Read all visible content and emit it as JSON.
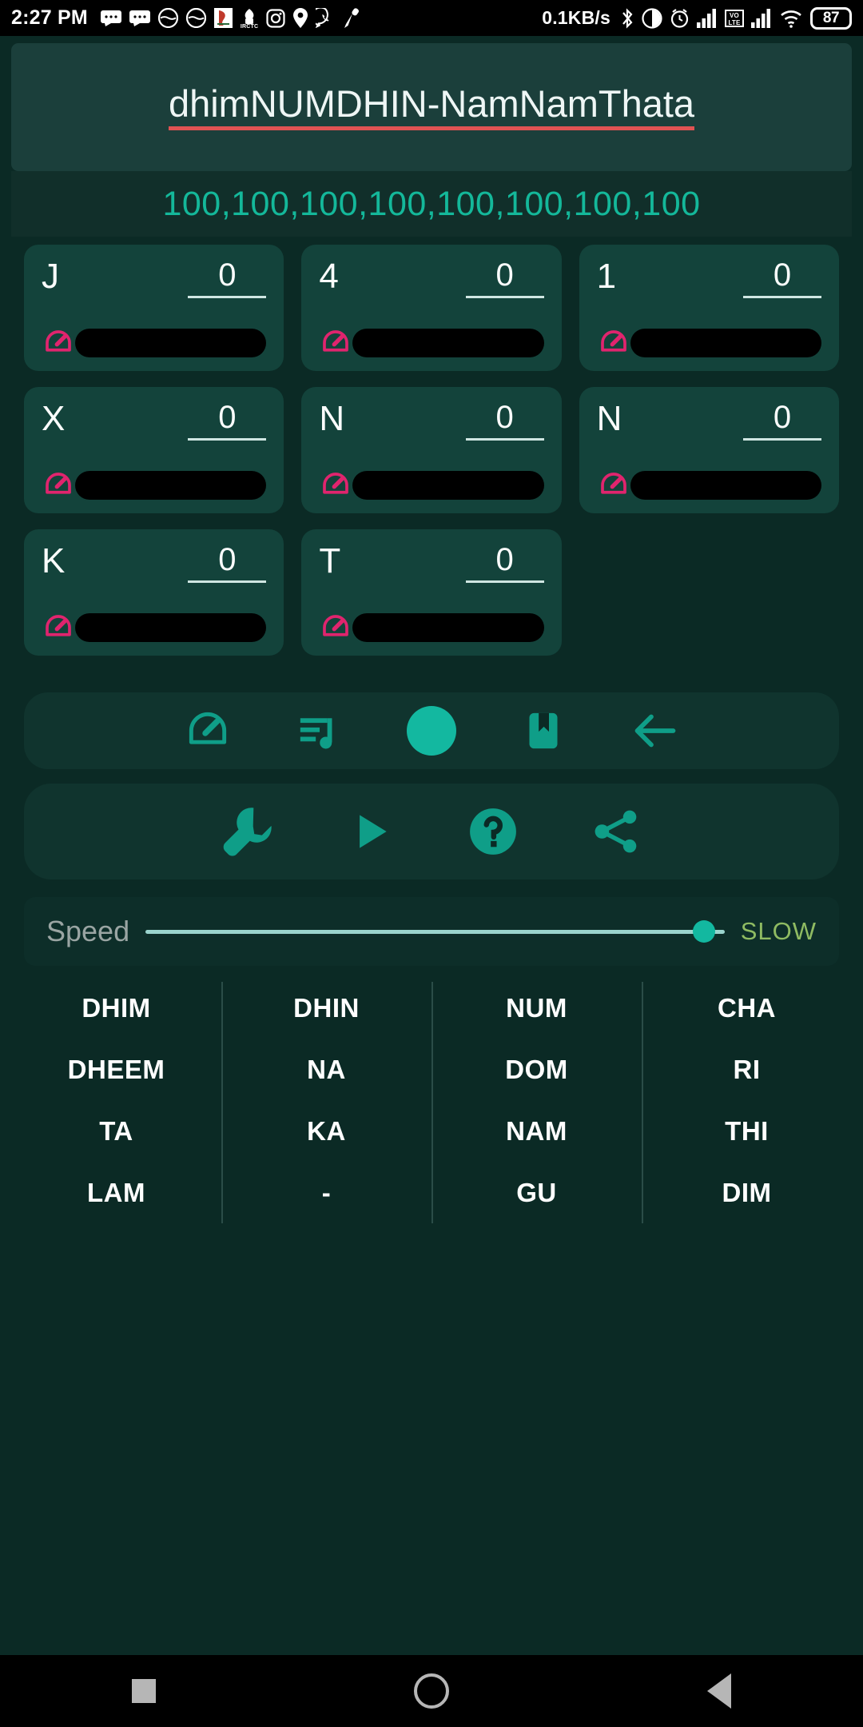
{
  "statusbar": {
    "clock": "2:27 PM",
    "net_rate": "0.1KB/s",
    "battery": "87",
    "left_icons": [
      "message-icon",
      "message-icon",
      "fitness-icon",
      "fitness-icon",
      "indian-rail-icon",
      "irctc-icon",
      "instagram-icon",
      "location-pin-icon",
      "whatsapp-icon",
      "mic-icon"
    ],
    "right_icons": [
      "bluetooth-icon",
      "dnd-icon",
      "alarm-icon",
      "signal-bars-icon",
      "volte-icon",
      "signal-bars-icon",
      "wifi-icon"
    ]
  },
  "header": {
    "title": "dhimNUMDHIN-NamNamThata",
    "underline_color": "#e05353"
  },
  "counts": {
    "text": "100,100,100,100,100,100,100,100",
    "color": "#14b89a"
  },
  "beat_cards": [
    {
      "letter": "J",
      "value": "0",
      "icon": "gauge-icon",
      "redacted": true
    },
    {
      "letter": "4",
      "value": "0",
      "icon": "gauge-icon",
      "redacted": true
    },
    {
      "letter": "1",
      "value": "0",
      "icon": "gauge-icon",
      "redacted": true
    },
    {
      "letter": "X",
      "value": "0",
      "icon": "gauge-icon",
      "redacted": true
    },
    {
      "letter": "N",
      "value": "0",
      "icon": "gauge-icon",
      "redacted": true
    },
    {
      "letter": "N",
      "value": "0",
      "icon": "gauge-icon",
      "redacted": true
    },
    {
      "letter": "K",
      "value": "0",
      "icon": "gauge-icon",
      "redacted": true
    },
    {
      "letter": "T",
      "value": "0",
      "icon": "gauge-icon",
      "redacted": true
    }
  ],
  "toolbar_primary": [
    {
      "name": "tempo-gauge-button",
      "icon": "gauge-icon"
    },
    {
      "name": "playlist-button",
      "icon": "playlist-music-icon"
    },
    {
      "name": "record-button",
      "icon": "filled-circle-icon"
    },
    {
      "name": "bookmark-button",
      "icon": "bookmark-icon"
    },
    {
      "name": "back-arrow-button",
      "icon": "arrow-left-icon"
    }
  ],
  "toolbar_secondary": [
    {
      "name": "settings-button",
      "icon": "wrench-icon"
    },
    {
      "name": "play-button",
      "icon": "play-icon"
    },
    {
      "name": "help-button",
      "icon": "question-circle-icon"
    },
    {
      "name": "share-button",
      "icon": "share-icon"
    }
  ],
  "speed": {
    "label": "Speed",
    "value_label": "SLOW",
    "thumb_position_percent": 97,
    "accent": "#13b8a0"
  },
  "syllables": {
    "columns": [
      [
        "DHIM",
        "DHEEM",
        "TA",
        "LAM"
      ],
      [
        "DHIN",
        "NA",
        "KA",
        "-"
      ],
      [
        "NUM",
        "DOM",
        "NAM",
        "GU"
      ],
      [
        "CHA",
        "RI",
        "THI",
        "DIM"
      ]
    ]
  },
  "navbar": [
    {
      "name": "recents-button",
      "icon": "square-icon"
    },
    {
      "name": "home-button",
      "icon": "circle-icon"
    },
    {
      "name": "back-button",
      "icon": "triangle-left-icon"
    }
  ]
}
